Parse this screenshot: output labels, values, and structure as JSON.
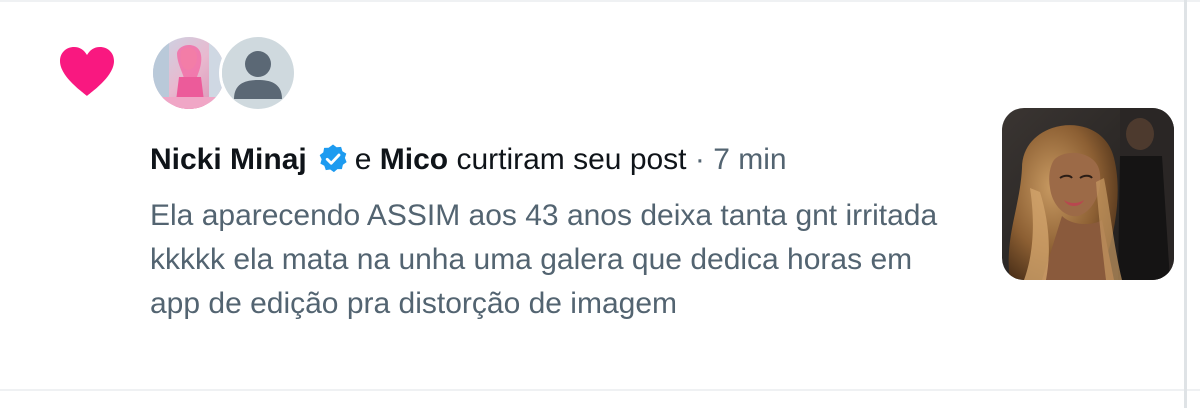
{
  "notification": {
    "type_icon": "heart-icon",
    "accent_color": "#f91880",
    "verified_color": "#1d9bf0",
    "avatars": [
      {
        "icon": "profile-photo-avatar"
      },
      {
        "icon": "default-user-avatar"
      }
    ],
    "actor_1": "Nicki Minaj",
    "connector": "e",
    "actor_2": "Mico",
    "action": "curtiram seu post",
    "separator": "·",
    "time": "7 min",
    "post_preview": "Ela aparecendo ASSIM aos 43 anos deixa tanta gnt irritada kkkkk ela mata na unha uma galera que dedica horas em app de edição pra distorção de imagem",
    "thumbnail_icon": "post-photo-thumbnail"
  }
}
